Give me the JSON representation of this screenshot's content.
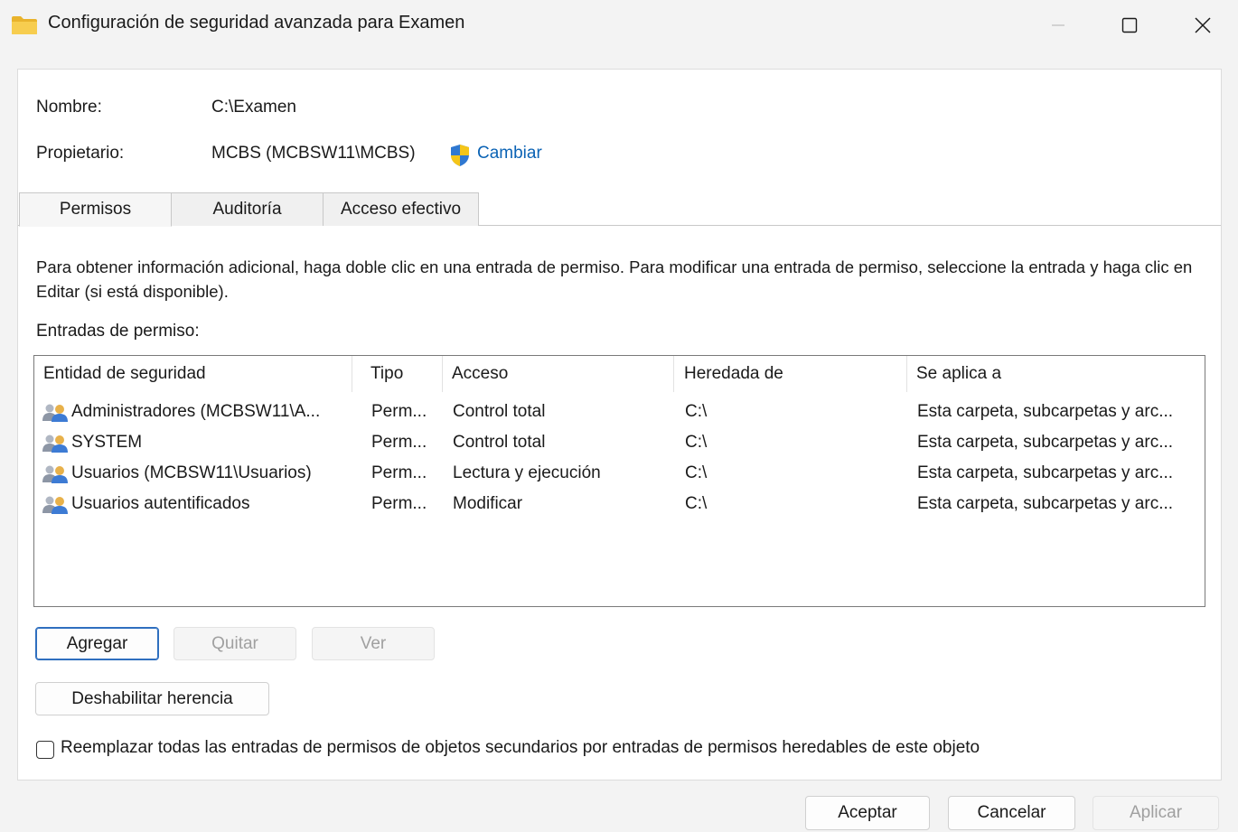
{
  "window": {
    "title": "Configuración de seguridad avanzada para Examen",
    "folder_icon": "folder-icon",
    "controls": {
      "minimize": "minimize-icon",
      "maximize": "maximize-icon",
      "close": "close-icon"
    }
  },
  "object": {
    "name_label": "Nombre:",
    "name_value": "C:\\Examen",
    "owner_label": "Propietario:",
    "owner_value": "MCBS (MCBSW11\\MCBS)",
    "change_link": "Cambiar",
    "shield_icon": "uac-shield-icon"
  },
  "tabs": [
    {
      "label": "Permisos",
      "active": true
    },
    {
      "label": "Auditoría",
      "active": false
    },
    {
      "label": "Acceso efectivo",
      "active": false
    }
  ],
  "info_text": "Para obtener información adicional, haga doble clic en una entrada de permiso. Para modificar una entrada de permiso, seleccione la entrada y haga clic en Editar (si está disponible).",
  "entries_label": "Entradas de permiso:",
  "table": {
    "columns": [
      "Entidad de seguridad",
      "Tipo",
      "Acceso",
      "Heredada de",
      "Se aplica a"
    ],
    "rows": [
      [
        "Administradores (MCBSW11\\A...",
        "Perm...",
        "Control total",
        "C:\\",
        "Esta carpeta, subcarpetas y arc..."
      ],
      [
        "SYSTEM",
        "Perm...",
        "Control total",
        "C:\\",
        "Esta carpeta, subcarpetas y arc..."
      ],
      [
        "Usuarios (MCBSW11\\Usuarios)",
        "Perm...",
        "Lectura y ejecución",
        "C:\\",
        "Esta carpeta, subcarpetas y arc..."
      ],
      [
        "Usuarios autentificados",
        "Perm...",
        "Modificar",
        "C:\\",
        "Esta carpeta, subcarpetas y arc..."
      ]
    ],
    "row_icon": "users-group-icon"
  },
  "buttons": {
    "agregar": "Agregar",
    "quitar": "Quitar",
    "ver": "Ver",
    "deshabilitar": "Deshabilitar herencia",
    "aceptar": "Aceptar",
    "cancelar": "Cancelar",
    "aplicar": "Aplicar"
  },
  "checkbox": {
    "label": "Reemplazar todas las entradas de permisos de objetos secundarios por entradas de permisos heredables de este objeto",
    "checked": false
  },
  "colors": {
    "link": "#0b63b5",
    "accent": "#2f6fbf",
    "folder": "#f5c342"
  }
}
